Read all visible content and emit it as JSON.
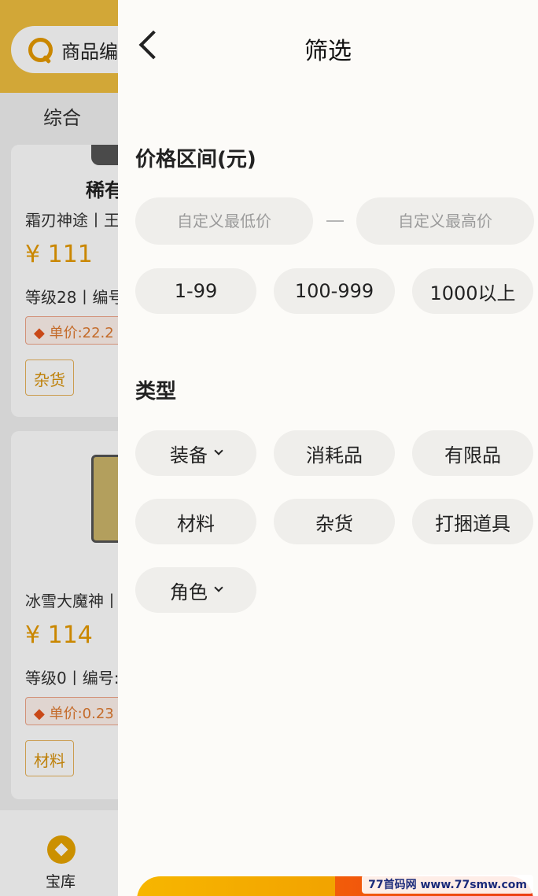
{
  "background": {
    "search_placeholder": "商品编",
    "sort_tab": "综合",
    "cards": [
      {
        "title": "稀有",
        "meta1": "霜刃神途丨王",
        "price": "¥ 111",
        "meta2": "等级28丨编号",
        "unit_price": "单价:22.2",
        "tag": "杂货"
      },
      {
        "title": "",
        "meta1": "冰雪大魔神丨",
        "price": "¥ 114",
        "meta2": "等级0丨编号:",
        "unit_price": "单价:0.23",
        "tag": "材料"
      }
    ],
    "nav": {
      "item_label": "宝库"
    }
  },
  "drawer": {
    "title": "筛选",
    "price_section": {
      "title": "价格区间(元)",
      "min_placeholder": "自定义最低价",
      "max_placeholder": "自定义最高价",
      "presets": [
        "1-99",
        "100-999",
        "1000以上"
      ]
    },
    "type_section": {
      "title": "类型",
      "options": [
        "装备",
        "消耗品",
        "有限品",
        "材料",
        "杂货",
        "打捆道具",
        "角色"
      ]
    }
  },
  "watermark": "77首码网 www.77smw.com",
  "colors": {
    "accent": "#f0bf3f",
    "price": "#e69a00",
    "confirm": "#ec3d12"
  }
}
